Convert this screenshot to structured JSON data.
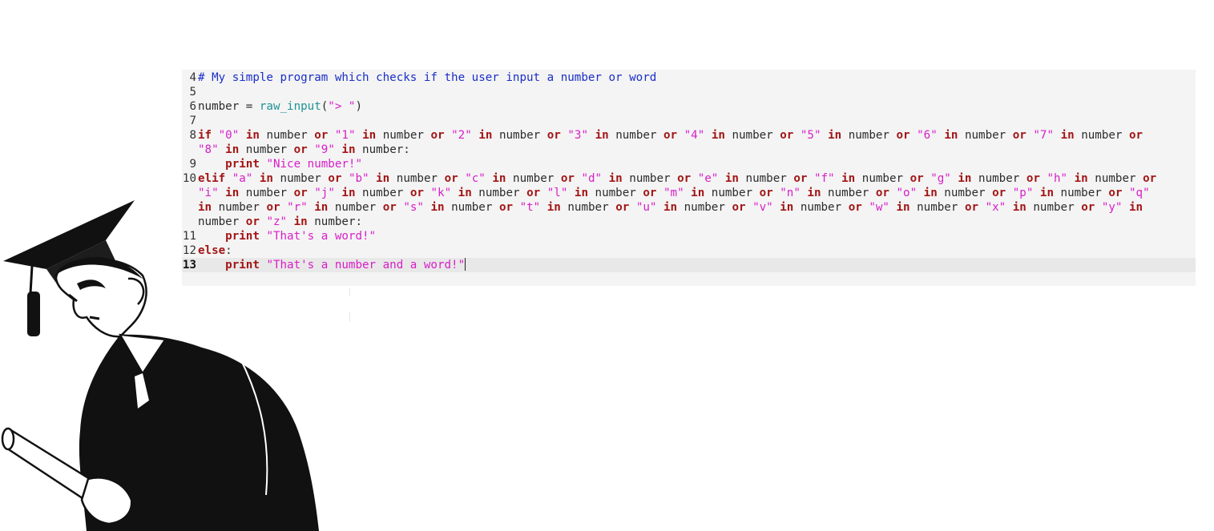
{
  "editor": {
    "lines": [
      {
        "num": "4",
        "text": "# My simple program which checks if the user input a number or word"
      },
      {
        "num": "5",
        "text": ""
      },
      {
        "num": "6",
        "text": "number = raw_input(\"> \")"
      },
      {
        "num": "7",
        "text": ""
      },
      {
        "num": "8",
        "text": "if \"0\" in number or \"1\" in number or \"2\" in number or \"3\" in number or \"4\" in number or \"5\" in number or \"6\" in number or \"7\" in number or \"8\" in number or \"9\" in number:"
      },
      {
        "num": "9",
        "text": "    print \"Nice number!\""
      },
      {
        "num": "10",
        "text": "elif \"a\" in number or \"b\" in number or \"c\" in number or \"d\" in number or \"e\" in number or \"f\" in number or \"g\" in number or \"h\" in number or \"i\" in number or \"j\" in number or \"k\" in number or \"l\" in number or \"m\" in number or \"n\" in number or \"o\" in number or \"p\" in number or \"q\" in number or \"r\" in number or \"s\" in number or \"t\" in number or \"u\" in number or \"v\" in number or \"w\" in number or \"x\" in number or \"y\" in number or \"z\" in number:"
      },
      {
        "num": "11",
        "text": "    print \"That's a word!\""
      },
      {
        "num": "12",
        "text": "else:"
      },
      {
        "num": "13",
        "text": "    print \"That's a number and a word!\"",
        "current": true
      }
    ]
  },
  "colors": {
    "keyword": "#a31515",
    "string": "#d81ec8",
    "comment": "#1a2fc7",
    "builtin": "#1e9494",
    "editor_background": "#f4f4f4",
    "current_line": "#e8e8e8"
  },
  "illustration": {
    "subject": "graduate-student-reading-diploma"
  }
}
